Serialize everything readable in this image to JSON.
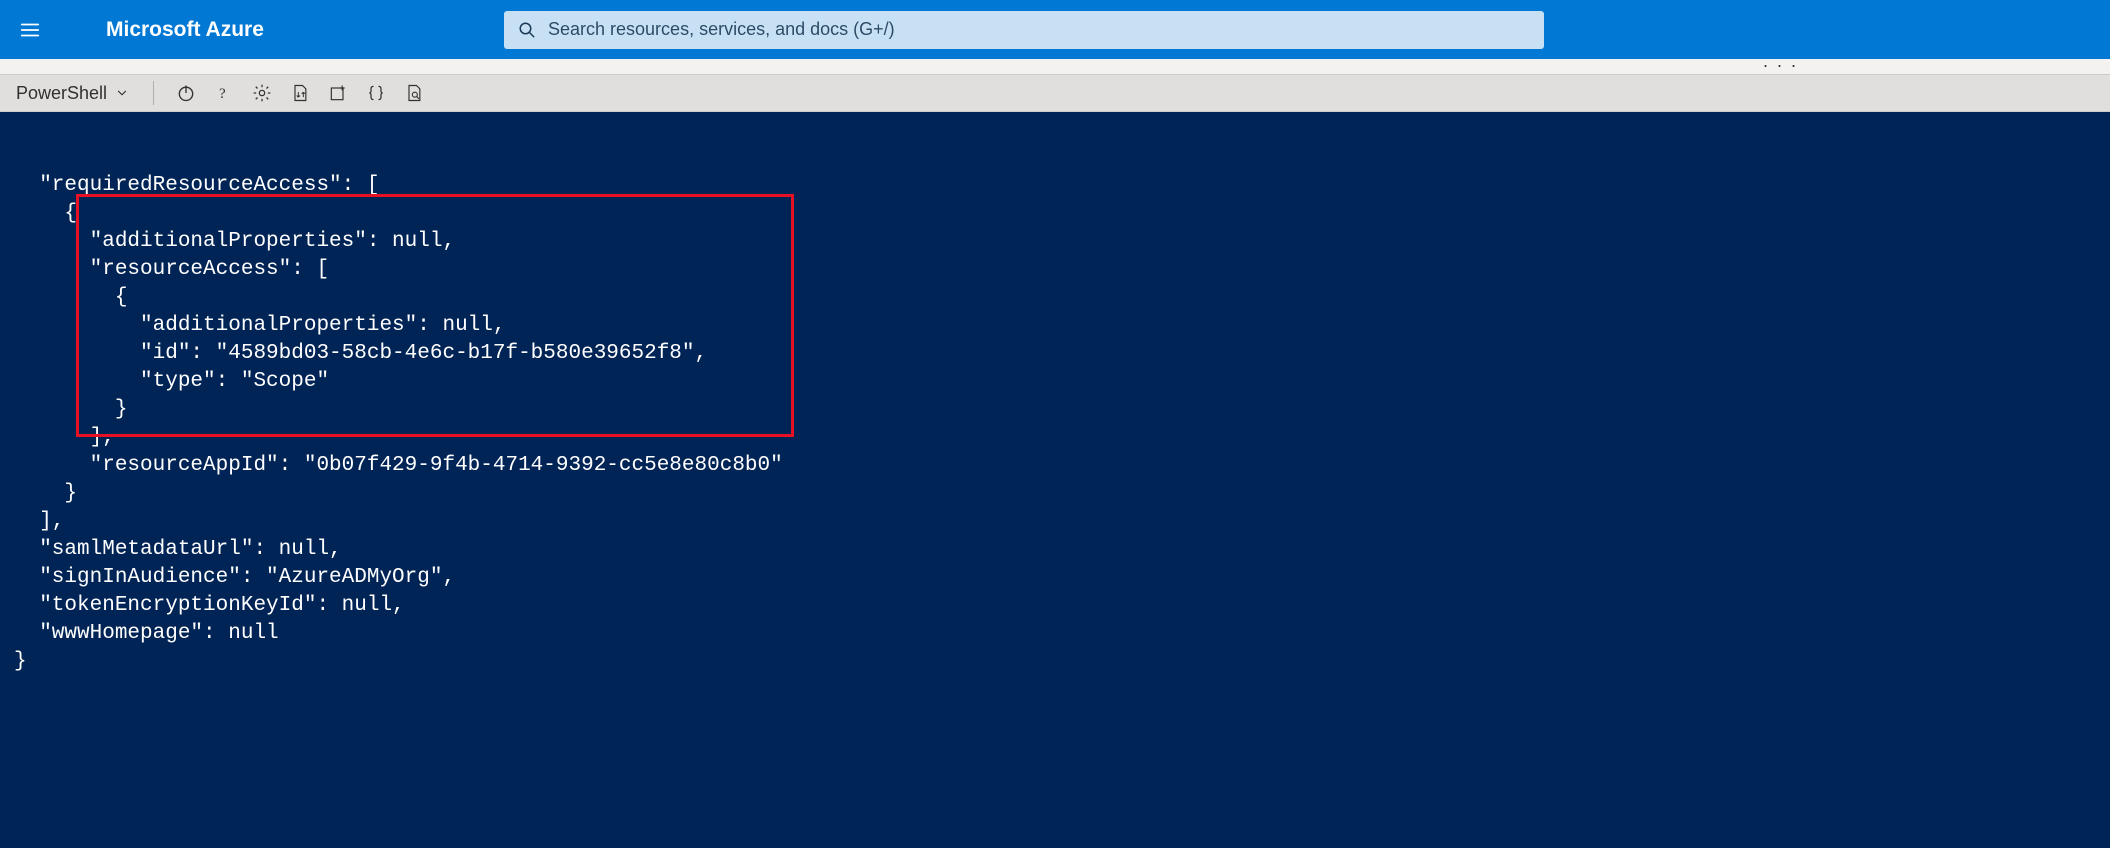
{
  "header": {
    "brand": "Microsoft Azure",
    "search_placeholder": "Search resources, services, and docs (G+/)"
  },
  "strip": {
    "dots": ". . ."
  },
  "shell": {
    "selector_label": "PowerShell"
  },
  "terminal": {
    "lines": [
      "  \"requiredResourceAccess\": [",
      "    {",
      "      \"additionalProperties\": null,",
      "      \"resourceAccess\": [",
      "        {",
      "          \"additionalProperties\": null,",
      "          \"id\": \"4589bd03-58cb-4e6c-b17f-b580e39652f8\",",
      "          \"type\": \"Scope\"",
      "        }",
      "      ],",
      "      \"resourceAppId\": \"0b07f429-9f4b-4714-9392-cc5e8e80c8b0\"",
      "    }",
      "  ],",
      "  \"samlMetadataUrl\": null,",
      "  \"signInAudience\": \"AzureADMyOrg\",",
      "  \"tokenEncryptionKeyId\": null,",
      "  \"wwwHomepage\": null",
      "}"
    ]
  }
}
